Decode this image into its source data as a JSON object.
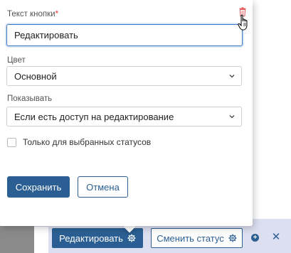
{
  "form": {
    "button_text_label": "Текст кнопки",
    "required_mark": "*",
    "button_text_value": "Редактировать",
    "color_label": "Цвет",
    "color_value": "Основной",
    "show_label": "Показывать",
    "show_value": "Если есть доступ на редактирование",
    "only_selected_statuses_label": "Только для выбранных статусов",
    "only_selected_statuses_checked": false,
    "save_label": "Сохранить",
    "cancel_label": "Отмена"
  },
  "toolbar": {
    "edit_label": "Редактировать",
    "change_status_label": "Сменить статус",
    "add_symbol": "+",
    "close_symbol": "✕"
  },
  "colors": {
    "primary": "#2b5f93",
    "toolbar_bg": "#dcdff0",
    "delete_icon": "#e05a5a"
  },
  "icons": [
    "trash-icon",
    "chevron-down-icon",
    "gear-icon",
    "plus-circle-icon",
    "close-icon",
    "hand-cursor-icon"
  ]
}
